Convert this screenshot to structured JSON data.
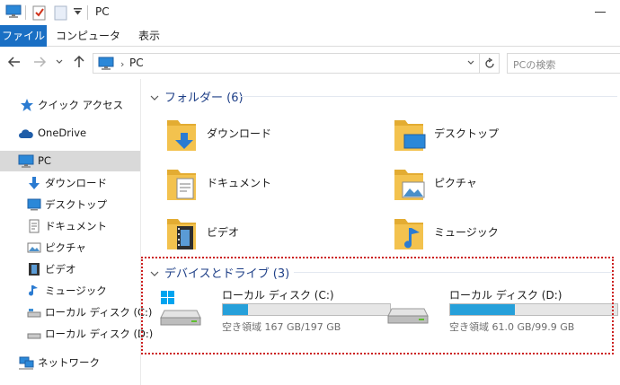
{
  "window": {
    "title": "PC"
  },
  "ribbon": {
    "tabs": [
      "ファイル",
      "コンピューター",
      "表示"
    ]
  },
  "address": {
    "path": "PC",
    "search_placeholder": "PCの検索"
  },
  "sidebar": {
    "items": [
      {
        "label": "クイック アクセス",
        "icon": "star-icon"
      },
      {
        "label": "OneDrive",
        "icon": "cloud-icon"
      },
      {
        "label": "PC",
        "icon": "computer-icon",
        "selected": true
      },
      {
        "label": "ダウンロード",
        "icon": "download-icon"
      },
      {
        "label": "デスクトップ",
        "icon": "desktop-icon"
      },
      {
        "label": "ドキュメント",
        "icon": "document-icon"
      },
      {
        "label": "ピクチャ",
        "icon": "picture-icon"
      },
      {
        "label": "ビデオ",
        "icon": "video-icon"
      },
      {
        "label": "ミュージック",
        "icon": "music-icon"
      },
      {
        "label": "ローカル ディスク (C:)",
        "icon": "drive-icon"
      },
      {
        "label": "ローカル ディスク (D:)",
        "icon": "drive-icon"
      },
      {
        "label": "ネットワーク",
        "icon": "network-icon"
      }
    ]
  },
  "folders": {
    "header": "フォルダー (6)",
    "items": [
      {
        "label": "ダウンロード",
        "icon": "download-folder-icon"
      },
      {
        "label": "デスクトップ",
        "icon": "desktop-folder-icon"
      },
      {
        "label": "ドキュメント",
        "icon": "documents-folder-icon"
      },
      {
        "label": "ピクチャ",
        "icon": "pictures-folder-icon"
      },
      {
        "label": "ビデオ",
        "icon": "videos-folder-icon"
      },
      {
        "label": "ミュージック",
        "icon": "music-folder-icon"
      }
    ]
  },
  "devices": {
    "header": "デバイスとドライブ (3)",
    "items": [
      {
        "name": "ローカル ディスク (C:)",
        "space": "空き領域 167 GB/197 GB",
        "used_fraction": 0.152,
        "icon": "windows-drive-icon"
      },
      {
        "name": "ローカル ディスク (D:)",
        "space": "空き領域 61.0 GB/99.9 GB",
        "used_fraction": 0.389,
        "icon": "hard-drive-icon"
      }
    ]
  },
  "colors": {
    "accent": "#1a6fc4",
    "folder": "#f3c24e",
    "drive_bar_fill": "#26a0da",
    "highlight_outline": "#cc1f1f",
    "group_header": "#1e3f87"
  }
}
